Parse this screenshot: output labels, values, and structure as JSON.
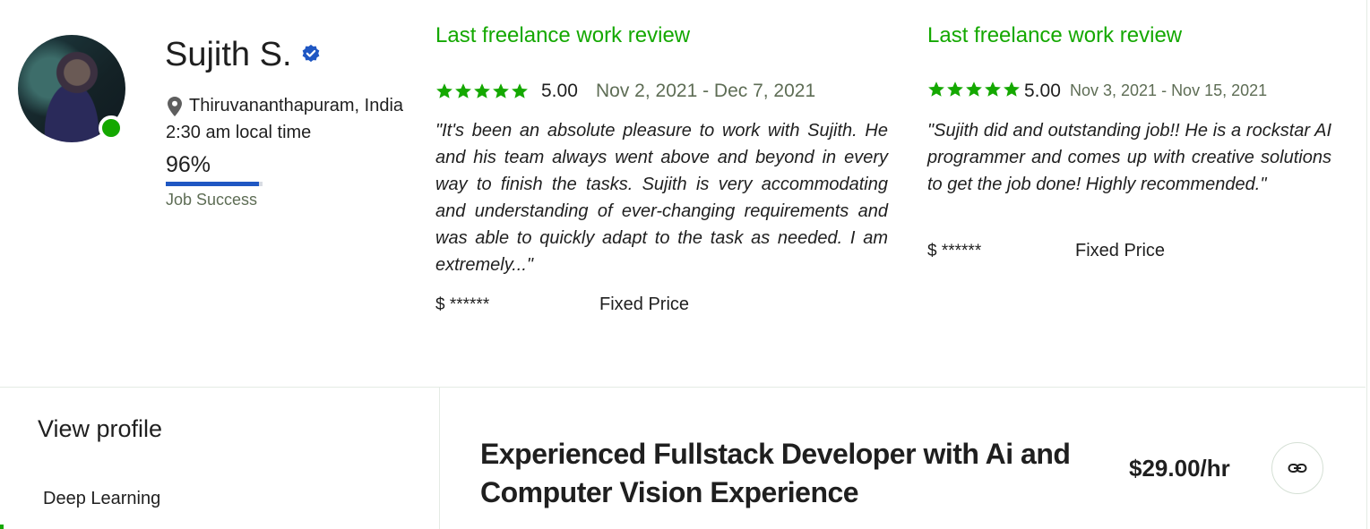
{
  "profile": {
    "name": "Sujith S.",
    "location": "Thiruvananthapuram, India",
    "local_time": "2:30 am local time",
    "job_success_value": "96%",
    "job_success_fraction": 0.96,
    "job_success_label": "Job Success"
  },
  "reviews": [
    {
      "heading": "Last freelance work review",
      "stars": 5,
      "rating": "5.00",
      "dates": "Nov 2, 2021 - Dec 7, 2021",
      "quote": "\"It's been an absolute pleasure to work with Sujith. He and his team always went above and beyond in every way to finish the tasks. Sujith is very accommodating and understanding of ever-changing requirements and was able to quickly adapt to the task as needed. I am extremely...\"",
      "price": "$ ******",
      "type": "Fixed Price"
    },
    {
      "heading": "Last freelance work review",
      "stars": 5,
      "rating": "5.00",
      "dates": "Nov 3, 2021 - Nov 15, 2021",
      "quote": "\"Sujith did and outstanding job!! He is a rockstar AI programmer and comes up with creative solutions to get the job done! Highly recommended.\"",
      "price": "$ ******",
      "type": "Fixed Price"
    }
  ],
  "sidebar": {
    "view_profile": "View profile",
    "skill": "Deep Learning"
  },
  "listing": {
    "title": "Experienced Fullstack Developer with Ai and Computer Vision Experience",
    "rate": "$29.00/hr",
    "link_icon": "link-icon"
  },
  "colors": {
    "accent_green": "#14a800",
    "verified_blue": "#1f57c3",
    "muted_text": "#5e6d55"
  }
}
